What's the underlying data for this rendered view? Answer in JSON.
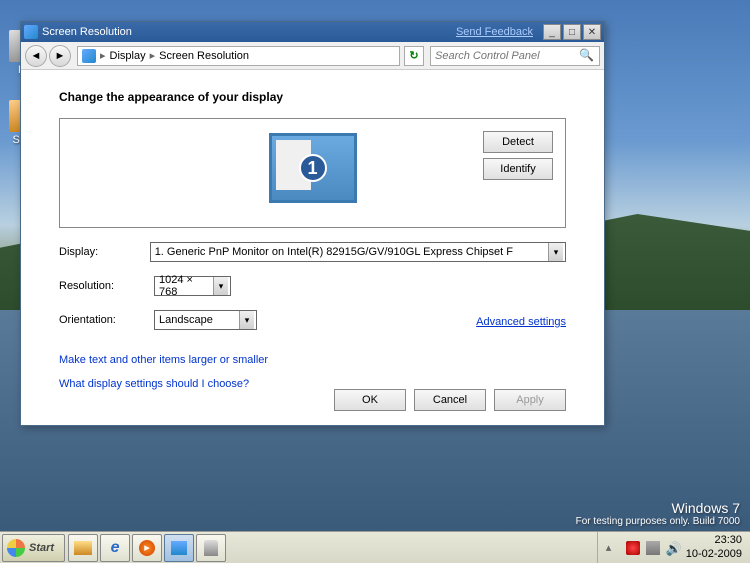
{
  "window": {
    "title": "Screen Resolution",
    "feedback_link": "Send Feedback"
  },
  "nav": {
    "breadcrumb": [
      "Display",
      "Screen Resolution"
    ],
    "search_placeholder": "Search Control Panel"
  },
  "content": {
    "heading": "Change the appearance of your display",
    "monitor_number": "1",
    "detect_btn": "Detect",
    "identify_btn": "Identify",
    "labels": {
      "display": "Display:",
      "resolution": "Resolution:",
      "orientation": "Orientation:"
    },
    "values": {
      "display": "1. Generic PnP Monitor on Intel(R) 82915G/GV/910GL Express Chipset F",
      "resolution": "1024 × 768",
      "orientation": "Landscape"
    },
    "advanced_link": "Advanced settings",
    "link1": "Make text and other items larger or smaller",
    "link2": "What display settings should I choose?",
    "ok_btn": "OK",
    "cancel_btn": "Cancel",
    "apply_btn": "Apply"
  },
  "desktop": {
    "watermark_title": "Windows  7",
    "watermark_sub": "For testing purposes only. Build 7000"
  },
  "taskbar": {
    "start": "Start",
    "time": "23:30",
    "date": "10-02-2009"
  },
  "desktop_icons": {
    "recycle": "Re",
    "senc": "Senc"
  }
}
